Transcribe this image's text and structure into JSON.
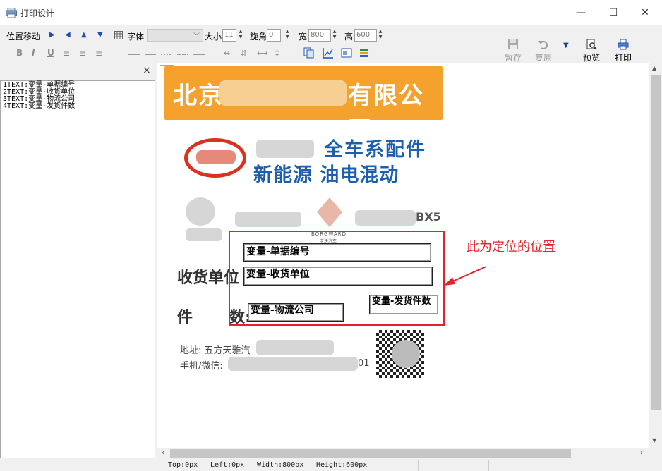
{
  "window": {
    "title": "打印设计",
    "min": "—",
    "max": "☐",
    "close": "✕"
  },
  "toolbar": {
    "position_move": "位置移动",
    "font_label": "字体",
    "size_label": "大小",
    "size_value": "11",
    "rotate_label": "旋角",
    "rotate_value": "0",
    "width_label": "宽",
    "width_value": "800",
    "height_label": "高",
    "height_value": "600",
    "bold": "B",
    "italic": "I",
    "underline": "U",
    "save_label": "暂存",
    "restore_label": "复原",
    "preview_label": "预览",
    "print_label": "打印",
    "dropdown": "▼"
  },
  "left_panel": {
    "close": "×",
    "items": [
      "1TEXT:变量-单据编号",
      "2TEXT:变量-收货单位",
      "3TEXT:变量-物流公司",
      "4TEXT:变量-发货件数"
    ]
  },
  "label": {
    "company_prefix": "北京",
    "company_suffix": "有限公司",
    "slogan1": "全车系配件",
    "slogan2": "新能源 油电混动",
    "model_text": "BX5",
    "brand_text": "BORGWARD",
    "brand_cn": "宝沃汽车",
    "receiver_label": "收货单位",
    "pieces_label1": "件",
    "pieces_label2": "数:",
    "address_label": "地址: 五方天雅汽",
    "phone_label": "手机/微信:",
    "phone_tail": "01"
  },
  "fields": {
    "doc_no": "变量-单据编号",
    "receiver": "变量-收货单位",
    "logistics": "变量-物流公司",
    "pieces": "变量-发货件数"
  },
  "annotation": "此为定位的位置",
  "status": {
    "top": "Top:0px",
    "left": "Left:0px",
    "width": "Width:800px",
    "height": "Height:600px"
  },
  "colors": {
    "label_orange": "#f5a12e",
    "annotation_red": "#e8202a",
    "slogan_blue": "#1d5fae"
  }
}
